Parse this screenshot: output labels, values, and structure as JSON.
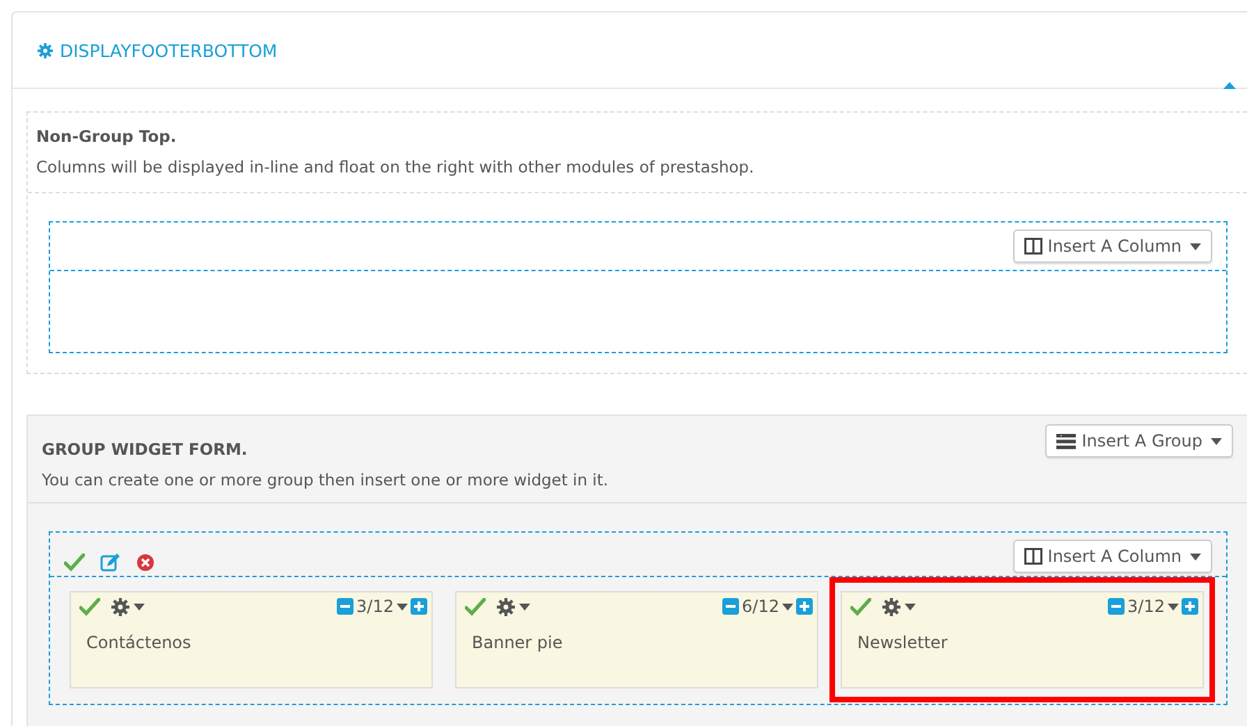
{
  "panel": {
    "title": "DISPLAYFOOTERBOTTOM",
    "expanded": true
  },
  "non_group": {
    "title": "Non-Group Top.",
    "description": "Columns will be displayed in-line and float on the right with other modules of prestashop.",
    "insert_column_button": "Insert A Column"
  },
  "group_form": {
    "title": "GROUP WIDGET FORM.",
    "description": "You can create one or more group then insert one or more widget in it.",
    "insert_group_button": "Insert A Group",
    "group": {
      "active": true,
      "insert_column_button": "Insert A Column",
      "columns": [
        {
          "name": "Contáctenos",
          "width": "3/12",
          "active": true,
          "highlighted": false
        },
        {
          "name": "Banner pie",
          "width": "6/12",
          "active": true,
          "highlighted": false
        },
        {
          "name": "Newsletter",
          "width": "3/12",
          "active": true,
          "highlighted": true
        }
      ]
    }
  }
}
